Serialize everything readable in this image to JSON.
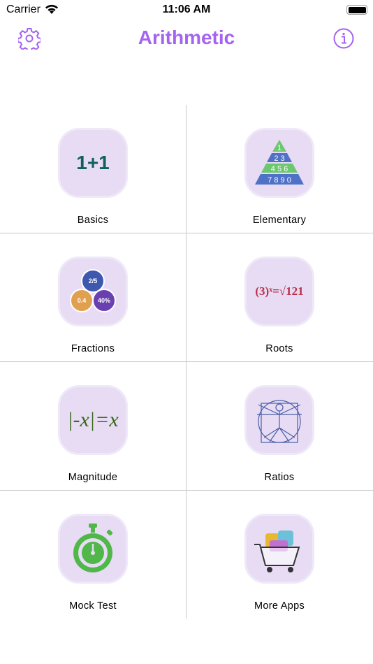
{
  "status": {
    "carrier": "Carrier",
    "time": "11:06 AM"
  },
  "header": {
    "title": "Arithmetic",
    "left_icon": "gear-icon",
    "right_icon": "info-icon"
  },
  "accent": "#a463f0",
  "items": [
    {
      "label": "Basics",
      "icon_text": "1+1"
    },
    {
      "label": "Elementary",
      "icon_text": [
        "1",
        "2 3",
        "4 5 6",
        "7 8 9 0"
      ]
    },
    {
      "label": "Fractions",
      "icon_text": [
        "2/5",
        "0.4",
        "40%"
      ]
    },
    {
      "label": "Roots",
      "icon_text": "(3)ˣ=√121"
    },
    {
      "label": "Magnitude",
      "icon_text": "|-x|=x"
    },
    {
      "label": "Ratios",
      "icon_text": ""
    },
    {
      "label": "Mock Test",
      "icon_text": ""
    },
    {
      "label": "More Apps",
      "icon_text": ""
    }
  ]
}
